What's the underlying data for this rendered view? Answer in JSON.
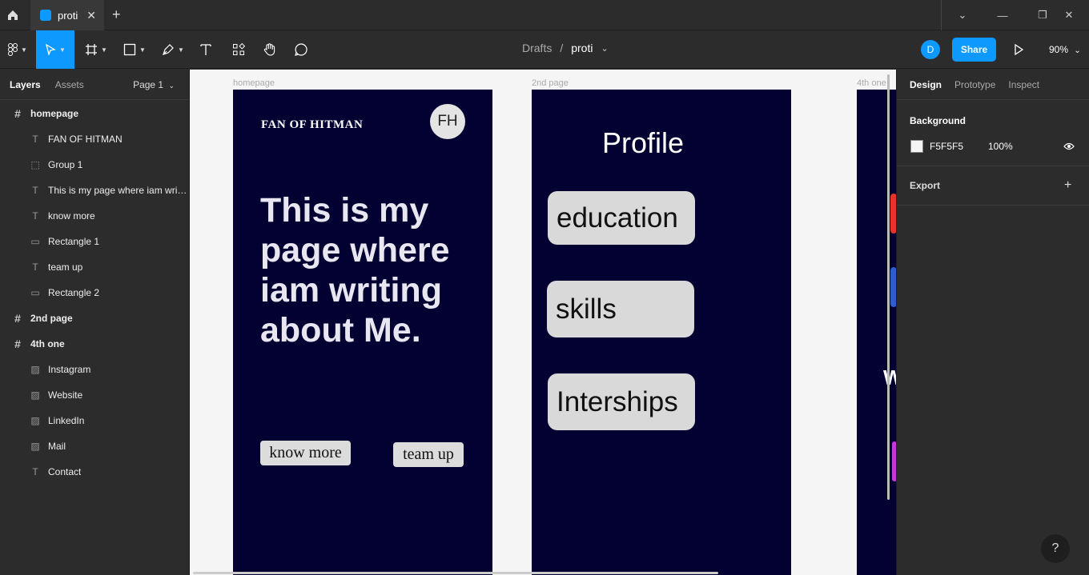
{
  "titlebar": {
    "tab_title": "proti",
    "close_glyph": "✕",
    "new_tab_glyph": "+",
    "controls": [
      "⌄",
      "—",
      "❐",
      "✕"
    ]
  },
  "toolbar": {
    "breadcrumb_root": "Drafts",
    "breadcrumb_sep": "/",
    "breadcrumb_file": "proti",
    "breadcrumb_caret": "⌄",
    "user_initial": "D",
    "share_label": "Share",
    "zoom": "90%",
    "zoom_caret": "⌄",
    "tools": [
      "figma-menu-icon",
      "move-icon",
      "frame-icon",
      "shape-icon",
      "pen-icon",
      "text-icon",
      "resources-icon",
      "hand-icon",
      "comment-icon"
    ],
    "accent": "#0d99ff"
  },
  "left_panel": {
    "tab_layers": "Layers",
    "tab_assets": "Assets",
    "page_selector": "Page 1",
    "page_caret": "⌄",
    "layers": [
      {
        "label": "homepage",
        "kind": "frame"
      },
      {
        "label": "FAN OF HITMAN",
        "kind": "text"
      },
      {
        "label": "Group 1",
        "kind": "group"
      },
      {
        "label": "This is my page where iam writing about Me.",
        "kind": "text"
      },
      {
        "label": "know more",
        "kind": "text"
      },
      {
        "label": "Rectangle 1",
        "kind": "rect"
      },
      {
        "label": "team up",
        "kind": "text"
      },
      {
        "label": "Rectangle 2",
        "kind": "rect"
      },
      {
        "label": "2nd page",
        "kind": "frame"
      },
      {
        "label": "4th one",
        "kind": "frame"
      },
      {
        "label": "Instagram",
        "kind": "image"
      },
      {
        "label": "Website",
        "kind": "image"
      },
      {
        "label": "LinkedIn",
        "kind": "image"
      },
      {
        "label": "Mail",
        "kind": "image"
      },
      {
        "label": "Contact",
        "kind": "text"
      }
    ]
  },
  "canvas": {
    "background": "#f5f5f5",
    "frame_color": "#020132",
    "homepage": {
      "label": "homepage",
      "logo": "FAN OF HITMAN",
      "avatar": "FH",
      "headline": "This is my page where iam writing about Me.",
      "btn_know_more": "know more",
      "btn_team_up": "team up"
    },
    "second": {
      "label": "2nd page",
      "title": "Profile",
      "cards": [
        "education",
        "skills",
        "Interships"
      ]
    },
    "fourth": {
      "label": "4th one"
    }
  },
  "right_panel": {
    "tab_design": "Design",
    "tab_prototype": "Prototype",
    "tab_inspect": "Inspect",
    "background_title": "Background",
    "background_hex": "F5F5F5",
    "background_opacity": "100%",
    "export_title": "Export",
    "export_add": "+"
  },
  "help": "?"
}
